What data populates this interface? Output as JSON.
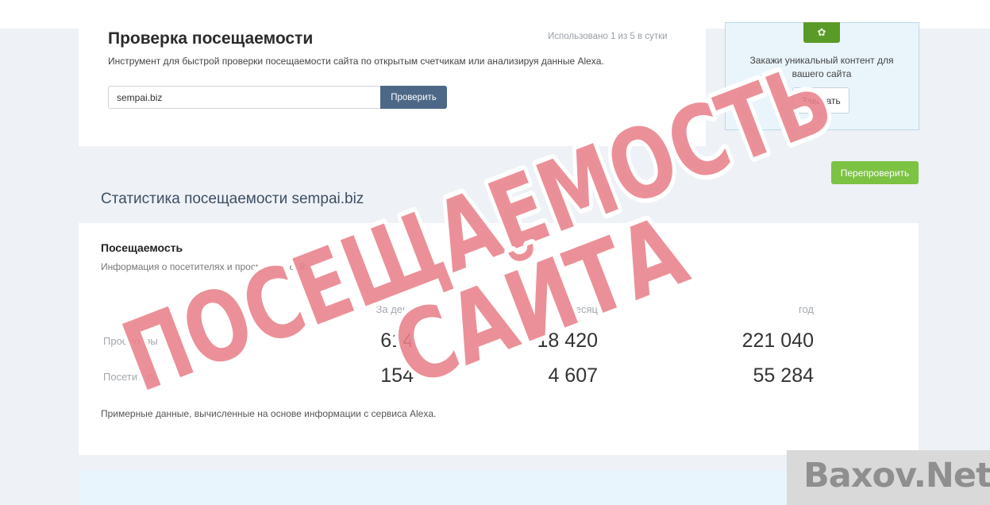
{
  "tool": {
    "title": "Проверка посещаемости",
    "usage": "Использовано 1 из 5 в сутки",
    "description": "Инструмент для быстрой проверки посещаемости сайта по открытым счетчикам или анализируя данные Alexa.",
    "input_value": "sempai.biz",
    "check_label": "Проверить"
  },
  "ad": {
    "icon": "star-badge-icon",
    "text": "Закажи уникальный контент для вашего сайта",
    "order_label": "Заказать"
  },
  "recheck_label": "Перепроверить",
  "stats": {
    "title": "Статистика посещаемости sempai.biz",
    "heading": "Посещаемость",
    "description": "Информация о посетителях и просмотрах сайта",
    "columns": [
      "За день",
      "месяц",
      "год"
    ],
    "rows": [
      {
        "label": "Просмотры",
        "values": [
          "614",
          "18 420",
          "221 040"
        ]
      },
      {
        "label": "Посетители",
        "values": [
          "154",
          "4 607",
          "55 284"
        ]
      }
    ],
    "footnote": "Примерные данные, вычисленные на основе информации с сервиса Alexa."
  },
  "overlay": {
    "line1": "ПОСЕЩАЕМОСТЬ",
    "line2": "САЙТА",
    "color": "#e8818a"
  },
  "watermark": "Baxov.Net"
}
